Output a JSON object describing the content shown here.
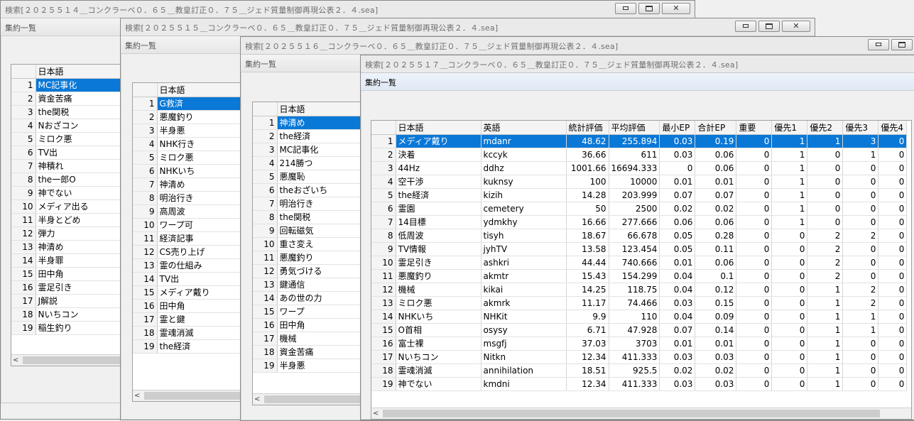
{
  "windows": [
    {
      "title": "検索[２０２５５１４＿コンクラーベ０．６５＿教皇訂正０．７５＿ジェド質量制御再現公表２．４.sea]",
      "subtitle": "集約一覧",
      "header": "日本語",
      "selected": 0,
      "rows": [
        "MC記事化",
        "資金苦痛",
        "the関税",
        "Nおざコン",
        "ミロク悪",
        "TV出",
        "神積れ",
        "the一郎O",
        "神でない",
        "メディア出る",
        "半身とどめ",
        "弾力",
        "神清め",
        "半身罪",
        "田中角",
        "霊足引き",
        "J解説",
        "Nいちコン",
        "稲生釣り"
      ]
    },
    {
      "title": "検索[２０２５５１５＿コンクラーベ０．６５＿教皇訂正０．７５＿ジェド質量制御再現公表２．４.sea]",
      "subtitle": "集約一覧",
      "header": "日本語",
      "selected": 0,
      "rows": [
        "G救済",
        "悪魔釣り",
        "半身悪",
        "NHK行き",
        "ミロク悪",
        "NHKいち",
        "神清め",
        "明治行き",
        "高周波",
        "ワープ可",
        "経済記事",
        "CS売り上げ",
        "霊の仕組み",
        "TV出",
        "メディア戴り",
        "田中角",
        "霊と鍵",
        "霊魂消滅",
        "the経済"
      ]
    },
    {
      "title": "検索[２０２５５１６＿コンクラーベ０．６５＿教皇訂正０．７５＿ジェド質量制御再現公表２．４.sea]",
      "subtitle": "集約一覧",
      "header": "日本語",
      "selected": 0,
      "rows": [
        "神清め",
        "the経済",
        "MC記事化",
        "214勝つ",
        "悪魔恥",
        "theおざいち",
        "明治行き",
        "the関税",
        "回転磁気",
        "重さ変え",
        "悪魔釣り",
        "勇気づける",
        "鍵通信",
        "あの世の力",
        "ワープ",
        "田中角",
        "機械",
        "資金苦痛",
        "半身悪"
      ]
    },
    {
      "title": "検索[２０２５５１７＿コンクラーベ０．６５＿教皇訂正０．７５＿ジェド質量制御再現公表２．４.sea]",
      "subtitle": "集約一覧",
      "headers": [
        "日本語",
        "英語",
        "統計評価",
        "平均評価",
        "最小EP",
        "合計EP",
        "重要",
        "優先1",
        "優先2",
        "優先3",
        "優先4"
      ],
      "selected": 0,
      "rows": [
        [
          "メディア戴り",
          "mdanr",
          "48.62",
          "255.894",
          "0.03",
          "0.19",
          "0",
          "1",
          "1",
          "3",
          "0"
        ],
        [
          "決着",
          "kccyk",
          "36.66",
          "611",
          "0.03",
          "0.06",
          "0",
          "1",
          "0",
          "1",
          "0"
        ],
        [
          "44Hz",
          "ddhz",
          "1001.66",
          "16694.333",
          "0",
          "0.06",
          "0",
          "1",
          "0",
          "0",
          "0"
        ],
        [
          "空干渉",
          "kuknsy",
          "100",
          "10000",
          "0.01",
          "0.01",
          "0",
          "1",
          "0",
          "0",
          "0"
        ],
        [
          "the経済",
          "kizih",
          "14.28",
          "203.999",
          "0.07",
          "0.07",
          "0",
          "1",
          "0",
          "0",
          "0"
        ],
        [
          "霊園",
          "cemetery",
          "50",
          "2500",
          "0.02",
          "0.02",
          "0",
          "1",
          "0",
          "0",
          "0"
        ],
        [
          "14目標",
          "ydmkhy",
          "16.66",
          "277.666",
          "0.06",
          "0.06",
          "0",
          "1",
          "0",
          "0",
          "0"
        ],
        [
          "低周波",
          "tisyh",
          "18.67",
          "66.678",
          "0.05",
          "0.28",
          "0",
          "0",
          "2",
          "2",
          "0"
        ],
        [
          "TV情報",
          "jyhTV",
          "13.58",
          "123.454",
          "0.05",
          "0.11",
          "0",
          "0",
          "2",
          "0",
          "0"
        ],
        [
          "霊足引き",
          "ashkri",
          "44.44",
          "740.666",
          "0.01",
          "0.06",
          "0",
          "0",
          "2",
          "0",
          "0"
        ],
        [
          "悪魔釣り",
          "akmtr",
          "15.43",
          "154.299",
          "0.04",
          "0.1",
          "0",
          "0",
          "2",
          "0",
          "0"
        ],
        [
          "機械",
          "kikai",
          "14.25",
          "118.75",
          "0.04",
          "0.12",
          "0",
          "0",
          "1",
          "2",
          "0"
        ],
        [
          "ミロク悪",
          "akmrk",
          "11.17",
          "74.466",
          "0.03",
          "0.15",
          "0",
          "0",
          "1",
          "2",
          "0"
        ],
        [
          "NHKいち",
          "NHKit",
          "9.9",
          "110",
          "0.04",
          "0.09",
          "0",
          "0",
          "1",
          "1",
          "0"
        ],
        [
          "O首相",
          "osysy",
          "6.71",
          "47.928",
          "0.07",
          "0.14",
          "0",
          "0",
          "1",
          "1",
          "0"
        ],
        [
          "富士裸",
          "msgfj",
          "37.03",
          "3703",
          "0.01",
          "0.01",
          "0",
          "0",
          "1",
          "0",
          "0"
        ],
        [
          "Nいちコン",
          "Nitkn",
          "12.34",
          "411.333",
          "0.03",
          "0.03",
          "0",
          "0",
          "1",
          "0",
          "0"
        ],
        [
          "霊魂消滅",
          "annihilation",
          "18.51",
          "925.5",
          "0.02",
          "0.02",
          "0",
          "0",
          "1",
          "0",
          "0"
        ],
        [
          "神でない",
          "kmdni",
          "12.34",
          "411.333",
          "0.03",
          "0.03",
          "0",
          "0",
          "1",
          "0",
          "0"
        ]
      ]
    }
  ]
}
